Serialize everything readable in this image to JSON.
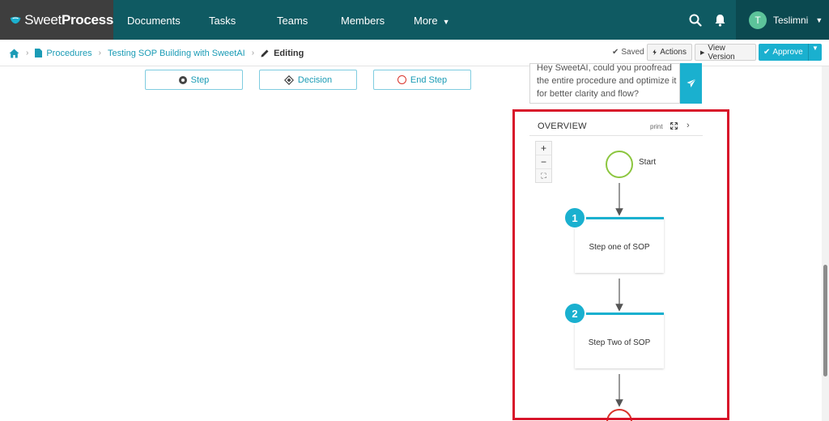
{
  "brand": {
    "name_light": "Sweet",
    "name_bold": "Process"
  },
  "nav": {
    "items": [
      {
        "label": "Documents"
      },
      {
        "label": "Tasks"
      },
      {
        "label": "Teams"
      },
      {
        "label": "Members"
      },
      {
        "label": "More"
      }
    ],
    "search_icon": "search-icon",
    "bell_icon": "bell-icon"
  },
  "user": {
    "initial": "T",
    "name": "Teslimni"
  },
  "breadcrumb": {
    "procedures": "Procedures",
    "document": "Testing SOP Building with SweetAI",
    "current": "Editing"
  },
  "toolbar": {
    "saved_label": "Saved",
    "actions_label": "Actions",
    "view_version_label": "View Version",
    "approve_label": "Approve"
  },
  "elements": {
    "step_label": "Step",
    "decision_label": "Decision",
    "end_step_label": "End Step"
  },
  "ai_prompt": {
    "text": "Hey SweetAI, could you proofread the entire procedure and optimize it for better clarity and flow?"
  },
  "overview": {
    "title": "OVERVIEW",
    "print_label": "print",
    "zoom_in": "+",
    "zoom_out": "−",
    "fit": "⛶",
    "flow": {
      "start_label": "Start",
      "steps": [
        {
          "number": "1",
          "label": "Step one of SOP"
        },
        {
          "number": "2",
          "label": "Step Two of SOP"
        }
      ]
    }
  },
  "colors": {
    "nav_bg": "#0f5a62",
    "brand_bg": "#3e3e3e",
    "accent": "#1ab0cf",
    "start_ring": "#8cc63f",
    "end_ring": "#d9342b",
    "highlight": "#d8152a"
  }
}
